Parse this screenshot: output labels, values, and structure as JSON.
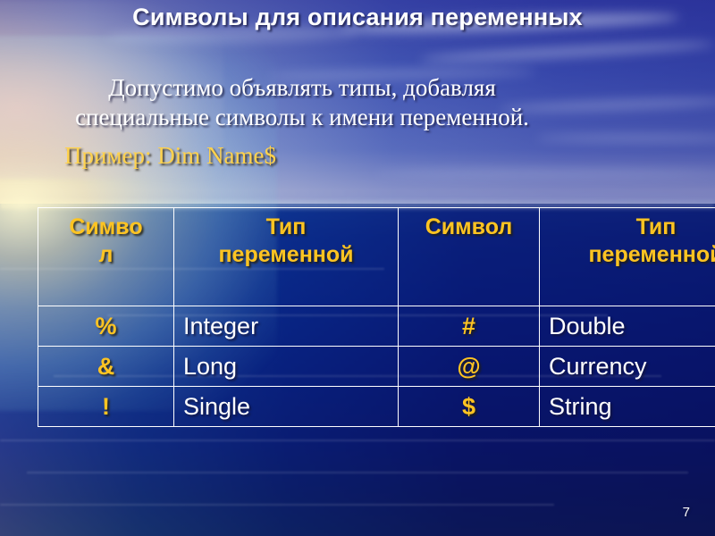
{
  "slide": {
    "title": "Символы для описания переменных",
    "page_number": "7",
    "accent_yellow": "#ffc422",
    "text_white": "#ffffff"
  },
  "body": {
    "line1": "Допустимо объявлять типы, добавляя",
    "line2": "специальные символы к имени переменной.",
    "example": "Пример: Dim Name$"
  },
  "table": {
    "headers": {
      "symbol_left_a": "Симво",
      "symbol_left_b": "л",
      "type_left_a": "Тип",
      "type_left_b": "переменной",
      "symbol_right": "Символ",
      "type_right_a": "Тип",
      "type_right_b": "переменной"
    },
    "rows": [
      {
        "symbol_left": "%",
        "type_left": "Integer",
        "symbol_right": "#",
        "type_right": "Double"
      },
      {
        "symbol_left": "&",
        "type_left": "Long",
        "symbol_right": "@",
        "type_right": "Currency"
      },
      {
        "symbol_left": "!",
        "type_left": "Single",
        "symbol_right": "$",
        "type_right": "String"
      }
    ]
  }
}
